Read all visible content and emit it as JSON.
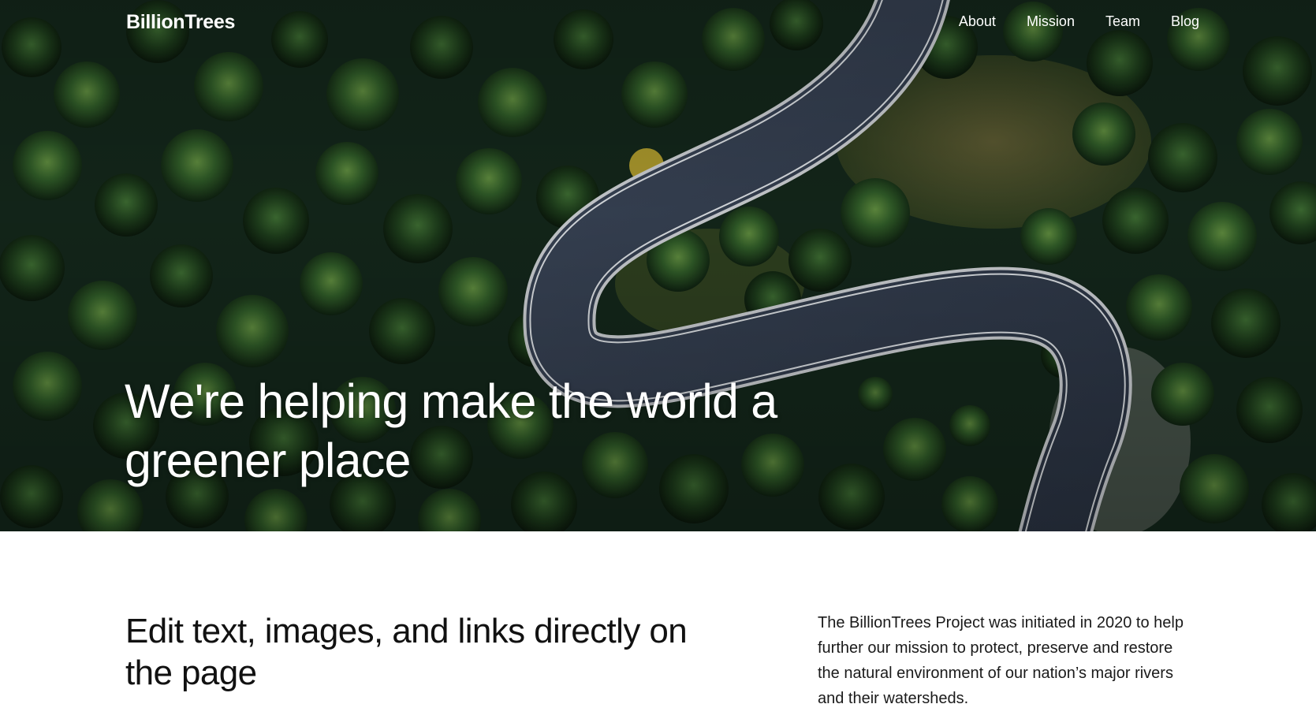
{
  "nav": {
    "brand": "BillionTrees",
    "links": [
      "About",
      "Mission",
      "Team",
      "Blog"
    ]
  },
  "hero": {
    "title": "We're helping make the world a greener place",
    "image": "aerial-forest-winding-road"
  },
  "content": {
    "title": "Edit text, images, and links directly on the page",
    "body": "The BillionTrees Project was initiated in 2020 to help further our mission to protect, preserve and restore the natural environment of our nation’s major rivers and their watersheds."
  },
  "colors": {
    "forest_dark": "#0f1d12",
    "road": "#2e3a4a",
    "text_dark": "#111111",
    "background": "#ffffff"
  }
}
